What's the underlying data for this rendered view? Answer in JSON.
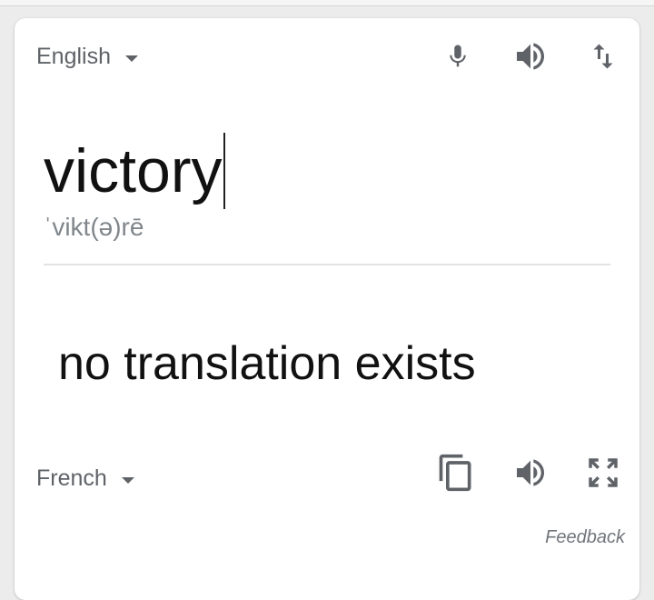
{
  "source": {
    "language": "English",
    "text": "victory",
    "phonetic": "ˈvikt(ə)rē",
    "icons": [
      "mic-icon",
      "speaker-icon",
      "swap-languages-icon"
    ]
  },
  "target": {
    "language": "French",
    "text": "no translation exists",
    "icons": [
      "copy-icon",
      "speaker-icon",
      "fullscreen-icon"
    ]
  },
  "feedback_label": "Feedback",
  "colors": {
    "text_primary": "#111111",
    "text_secondary": "#5f6368",
    "icon": "#5f6368",
    "divider": "#e3e3e3",
    "card": "#ffffff",
    "background": "#ececec"
  }
}
